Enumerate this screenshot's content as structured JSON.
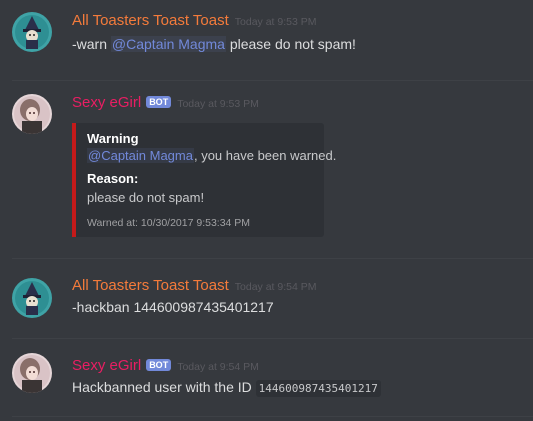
{
  "colors": {
    "background": "#36393e",
    "toaster_name": "#f47b3b",
    "egirl_name": "#e91e63",
    "bot_tag": "#7289da",
    "mention": "#7289da",
    "embed_bar": "#c41a1a"
  },
  "messages": [
    {
      "username": "All Toasters Toast Toast",
      "timestamp": "Today at 9:53 PM",
      "avatar_icon": "toaster-wizard-avatar-icon",
      "content": {
        "prefix": "-warn ",
        "mention": "@Captain Magma",
        "suffix": " please do not spam!"
      }
    },
    {
      "username": "Sexy eGirl",
      "bot_tag": "BOT",
      "timestamp": "Today at 9:53 PM",
      "avatar_icon": "egirl-avatar-icon",
      "embed": {
        "title": "Warning",
        "description_mention": "@Captain Magma",
        "description_suffix": ", you have been warned.",
        "field_name": "Reason:",
        "field_value": "please do not spam!",
        "footer": "Warned at: 10/30/2017 9:53:34 PM"
      }
    },
    {
      "username": "All Toasters Toast Toast",
      "timestamp": "Today at 9:54 PM",
      "avatar_icon": "toaster-wizard-avatar-icon",
      "content": {
        "text": "-hackban 144600987435401217"
      }
    },
    {
      "username": "Sexy eGirl",
      "bot_tag": "BOT",
      "timestamp": "Today at 9:54 PM",
      "avatar_icon": "egirl-avatar-icon",
      "content": {
        "text": "Hackbanned user with the ID ",
        "code": "144600987435401217"
      }
    }
  ]
}
